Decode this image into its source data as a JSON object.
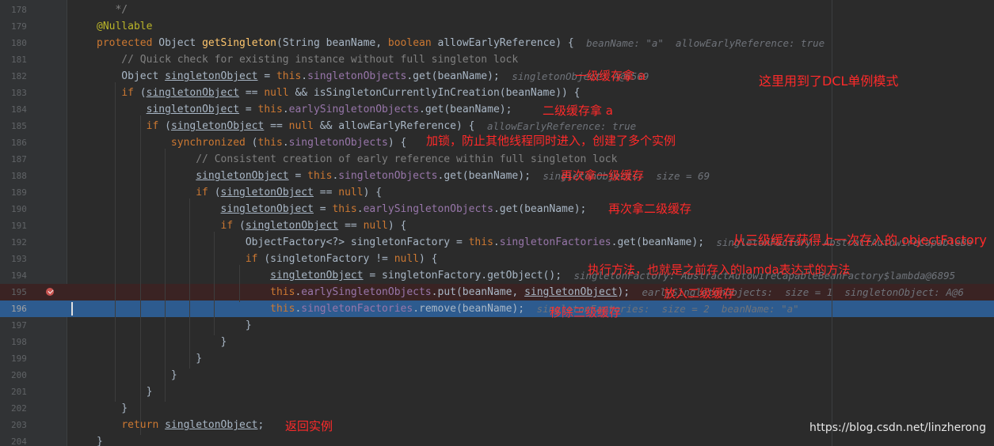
{
  "lines": [
    {
      "num": "178",
      "toks": [
        {
          "t": "   */",
          "c": "cm"
        }
      ]
    },
    {
      "num": "179",
      "toks": [
        {
          "t": "@Nullable",
          "c": "an"
        }
      ]
    },
    {
      "num": "180",
      "toks": [
        {
          "t": "protected ",
          "c": "kw"
        },
        {
          "t": "Object "
        },
        {
          "t": "getSingleton",
          "c": "fn"
        },
        {
          "t": "(String beanName, "
        },
        {
          "t": "boolean ",
          "c": "kw"
        },
        {
          "t": "allowEarlyReference) {"
        }
      ],
      "hint": "beanName: \"a\"  allowEarlyReference: true"
    },
    {
      "num": "181",
      "toks": [
        {
          "t": "    // Quick check for existing instance without full singleton lock",
          "c": "cm"
        }
      ]
    },
    {
      "num": "182",
      "toks": [
        {
          "t": "    Object "
        },
        {
          "t": "singletonObject",
          "c": "uv"
        },
        {
          "t": " = "
        },
        {
          "t": "this",
          "c": "kw"
        },
        {
          "t": "."
        },
        {
          "t": "singletonObjects",
          "c": "fld"
        },
        {
          "t": ".get(beanName);"
        }
      ],
      "hint": "singletonObject: A@6569"
    },
    {
      "num": "183",
      "toks": [
        {
          "t": "    "
        },
        {
          "t": "if ",
          "c": "kw"
        },
        {
          "t": "("
        },
        {
          "t": "singletonObject",
          "c": "uv"
        },
        {
          "t": " == "
        },
        {
          "t": "null ",
          "c": "kw"
        },
        {
          "t": "&& isSingletonCurrentlyInCreation(beanName)) {"
        }
      ]
    },
    {
      "num": "184",
      "toks": [
        {
          "t": "        "
        },
        {
          "t": "singletonObject",
          "c": "uv"
        },
        {
          "t": " = "
        },
        {
          "t": "this",
          "c": "kw"
        },
        {
          "t": "."
        },
        {
          "t": "earlySingletonObjects",
          "c": "fld"
        },
        {
          "t": ".get(beanName);"
        }
      ]
    },
    {
      "num": "185",
      "toks": [
        {
          "t": "        "
        },
        {
          "t": "if ",
          "c": "kw"
        },
        {
          "t": "("
        },
        {
          "t": "singletonObject",
          "c": "uv"
        },
        {
          "t": " == "
        },
        {
          "t": "null ",
          "c": "kw"
        },
        {
          "t": "&& allowEarlyReference) {"
        }
      ],
      "hint": "allowEarlyReference: true"
    },
    {
      "num": "186",
      "toks": [
        {
          "t": "            "
        },
        {
          "t": "synchronized ",
          "c": "kw"
        },
        {
          "t": "("
        },
        {
          "t": "this",
          "c": "kw"
        },
        {
          "t": "."
        },
        {
          "t": "singletonObjects",
          "c": "fld"
        },
        {
          "t": ") {"
        }
      ]
    },
    {
      "num": "187",
      "toks": [
        {
          "t": "                // Consistent creation of early reference within full singleton lock",
          "c": "cm"
        }
      ]
    },
    {
      "num": "188",
      "toks": [
        {
          "t": "                "
        },
        {
          "t": "singletonObject",
          "c": "uv"
        },
        {
          "t": " = "
        },
        {
          "t": "this",
          "c": "kw"
        },
        {
          "t": "."
        },
        {
          "t": "singletonObjects",
          "c": "fld"
        },
        {
          "t": ".get(beanName);"
        }
      ],
      "hint": "singletonObjects:  size = 69"
    },
    {
      "num": "189",
      "toks": [
        {
          "t": "                "
        },
        {
          "t": "if ",
          "c": "kw"
        },
        {
          "t": "("
        },
        {
          "t": "singletonObject",
          "c": "uv"
        },
        {
          "t": " == "
        },
        {
          "t": "null",
          "c": "kw"
        },
        {
          "t": ") {"
        }
      ]
    },
    {
      "num": "190",
      "toks": [
        {
          "t": "                    "
        },
        {
          "t": "singletonObject",
          "c": "uv"
        },
        {
          "t": " = "
        },
        {
          "t": "this",
          "c": "kw"
        },
        {
          "t": "."
        },
        {
          "t": "earlySingletonObjects",
          "c": "fld"
        },
        {
          "t": ".get(beanName);"
        }
      ]
    },
    {
      "num": "191",
      "toks": [
        {
          "t": "                    "
        },
        {
          "t": "if ",
          "c": "kw"
        },
        {
          "t": "("
        },
        {
          "t": "singletonObject",
          "c": "uv"
        },
        {
          "t": " == "
        },
        {
          "t": "null",
          "c": "kw"
        },
        {
          "t": ") {"
        }
      ]
    },
    {
      "num": "192",
      "toks": [
        {
          "t": "                        ObjectFactory<?> singletonFactory = "
        },
        {
          "t": "this",
          "c": "kw"
        },
        {
          "t": "."
        },
        {
          "t": "singletonFactories",
          "c": "fld"
        },
        {
          "t": ".get(beanName);"
        }
      ],
      "hint": "singletonFactory: AbstractAutowireCapableBe"
    },
    {
      "num": "193",
      "toks": [
        {
          "t": "                        "
        },
        {
          "t": "if ",
          "c": "kw"
        },
        {
          "t": "(singletonFactory != "
        },
        {
          "t": "null",
          "c": "kw"
        },
        {
          "t": ") {"
        }
      ]
    },
    {
      "num": "194",
      "toks": [
        {
          "t": "                            "
        },
        {
          "t": "singletonObject",
          "c": "uv"
        },
        {
          "t": " = singletonFactory.getObject();"
        }
      ],
      "hint": "singletonFactory: AbstractAutowireCapableBeanFactory$lambda@6895"
    },
    {
      "num": "195",
      "toks": [
        {
          "t": "                            "
        },
        {
          "t": "this",
          "c": "kw"
        },
        {
          "t": "."
        },
        {
          "t": "earlySingletonObjects",
          "c": "fld"
        },
        {
          "t": ".put(beanName, "
        },
        {
          "t": "singletonObject",
          "c": "uv"
        },
        {
          "t": ");"
        }
      ],
      "hint": "earlySingletonObjects:  size = 1  singletonObject: A@6"
    },
    {
      "num": "196",
      "toks": [
        {
          "t": "                            "
        },
        {
          "t": "this",
          "c": "kw"
        },
        {
          "t": "."
        },
        {
          "t": "singletonFactories",
          "c": "fld"
        },
        {
          "t": ".remove(beanName);"
        }
      ],
      "hint": "singletonFactories:  size = 2  beanName: \"a\""
    },
    {
      "num": "197",
      "toks": [
        {
          "t": "                        }"
        }
      ]
    },
    {
      "num": "198",
      "toks": [
        {
          "t": "                    }"
        }
      ]
    },
    {
      "num": "199",
      "toks": [
        {
          "t": "                }"
        }
      ]
    },
    {
      "num": "200",
      "toks": [
        {
          "t": "            }"
        }
      ]
    },
    {
      "num": "201",
      "toks": [
        {
          "t": "        }"
        }
      ]
    },
    {
      "num": "202",
      "toks": [
        {
          "t": "    }"
        }
      ]
    },
    {
      "num": "203",
      "toks": [
        {
          "t": "    "
        },
        {
          "t": "return ",
          "c": "kw"
        },
        {
          "t": "singletonObject",
          "c": "uv"
        },
        {
          "t": ";"
        }
      ]
    },
    {
      "num": "204",
      "toks": [
        {
          "t": "}"
        }
      ]
    }
  ],
  "annotations": {
    "dcl": "这里用到了DCL单例模式",
    "l182": "一级缓存拿 a",
    "l184": "二级缓存拿 a",
    "l186": "加锁，防止其他线程同时进入，创建了多个实例",
    "l188": "再次拿一级缓存",
    "l190": "再次拿二级缓存",
    "l192": "从三级缓存获得上一次存入的 objectFactory",
    "l194": "执行方法，也就是之前存入的lamda表达式的方法",
    "l195": "放入二级缓存",
    "l196": "移除三级缓存",
    "l203": "返回实例"
  },
  "debugger": {
    "breakpoint_line": "195",
    "current_line": "196"
  },
  "watermark": "https://blog.csdn.net/linzherong",
  "colors": {
    "background": "#2b2b2b",
    "keyword": "#cc7832",
    "method": "#ffc66d",
    "field": "#9876aa",
    "comment": "#808080",
    "annotation_text": "#ff2a2a",
    "execution_line": "#2d5b8f"
  }
}
